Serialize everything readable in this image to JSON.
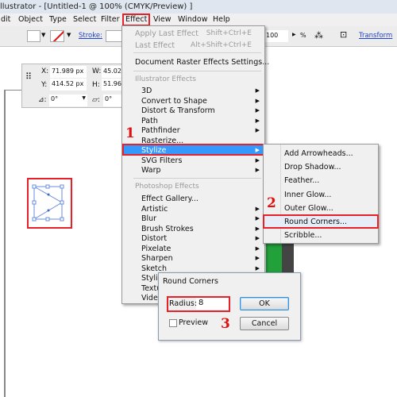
{
  "title": "llustrator - [Untitled-1 @ 100% (CMYK/Preview) ]",
  "menubar": [
    "dit",
    "Object",
    "Type",
    "Select",
    "Filter",
    "Effect",
    "View",
    "Window",
    "Help"
  ],
  "toolbar": {
    "stroke_label": "Stroke:",
    "opacity": "100",
    "percent": "%",
    "transform_label": "Transform"
  },
  "panel": {
    "x_label": "X:",
    "x": "71.989 px",
    "y_label": "Y:",
    "y": "414.52 px",
    "w_label": "W:",
    "w": "45.022",
    "h_label": "H:",
    "h": "51.962",
    "angle": "0°",
    "shear": "0°"
  },
  "effect_menu": {
    "apply_last": "Apply Last Effect",
    "apply_last_sc": "Shift+Ctrl+E",
    "last": "Last Effect",
    "last_sc": "Alt+Shift+Ctrl+E",
    "raster": "Document Raster Effects Settings...",
    "illustrator_header": "Illustrator Effects",
    "illustrator_items": [
      "3D",
      "Convert to Shape",
      "Distort & Transform",
      "Path",
      "Pathfinder",
      "Rasterize...",
      "Stylize",
      "SVG Filters",
      "Warp"
    ],
    "photoshop_header": "Photoshop Effects",
    "photoshop_items": [
      "Effect Gallery...",
      "Artistic",
      "Blur",
      "Brush Strokes",
      "Distort",
      "Pixelate",
      "Sharpen",
      "Sketch",
      "Stylize",
      "Texture",
      "Video"
    ]
  },
  "stylize_submenu": [
    "Add Arrowheads...",
    "Drop Shadow...",
    "Feather...",
    "Inner Glow...",
    "Outer Glow...",
    "Round Corners...",
    "Scribble..."
  ],
  "dialog": {
    "title": "Round Corners",
    "radius_label": "Radius:",
    "radius": "8",
    "preview_label": "Preview",
    "ok": "OK",
    "cancel": "Cancel"
  },
  "steps": [
    "1",
    "2",
    "3"
  ],
  "colors": {
    "highlight": "#3399ff",
    "annotation": "#e8202a",
    "selection": "#4a78e0"
  }
}
